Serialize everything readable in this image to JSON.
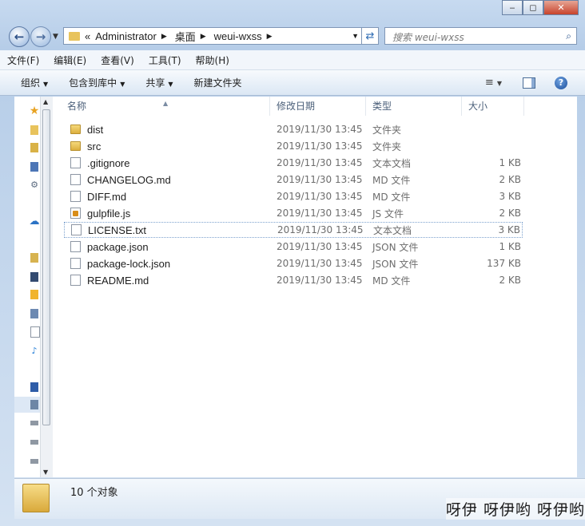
{
  "window": {
    "caption_buttons": {
      "minimize": "‒",
      "maximize": "◻",
      "close": "✕"
    }
  },
  "address_bar": {
    "prefix": "«",
    "crumbs": [
      "Administrator",
      "桌面",
      "weui-wxss"
    ],
    "search_placeholder": "搜索 weui-wxss"
  },
  "menu": [
    "文件(F)",
    "编辑(E)",
    "查看(V)",
    "工具(T)",
    "帮助(H)"
  ],
  "toolbar": {
    "organize": "组织",
    "include_library": "包含到库中",
    "share": "共享",
    "new_folder": "新建文件夹"
  },
  "columns": {
    "name": "名称",
    "date": "修改日期",
    "type": "类型",
    "size": "大小"
  },
  "files": [
    {
      "name": "dist",
      "date": "2019/11/30 13:45",
      "type": "文件夹",
      "size": "",
      "icon": "folder-icon"
    },
    {
      "name": "src",
      "date": "2019/11/30 13:45",
      "type": "文件夹",
      "size": "",
      "icon": "folder-icon"
    },
    {
      "name": ".gitignore",
      "date": "2019/11/30 13:45",
      "type": "文本文档",
      "size": "1 KB",
      "icon": "text-file-icon"
    },
    {
      "name": "CHANGELOG.md",
      "date": "2019/11/30 13:45",
      "type": "MD 文件",
      "size": "2 KB",
      "icon": "file-icon"
    },
    {
      "name": "DIFF.md",
      "date": "2019/11/30 13:45",
      "type": "MD 文件",
      "size": "3 KB",
      "icon": "file-icon"
    },
    {
      "name": "gulpfile.js",
      "date": "2019/11/30 13:45",
      "type": "JS 文件",
      "size": "2 KB",
      "icon": "js-file-icon"
    },
    {
      "name": "LICENSE.txt",
      "date": "2019/11/30 13:45",
      "type": "文本文档",
      "size": "3 KB",
      "icon": "text-file-icon"
    },
    {
      "name": "package.json",
      "date": "2019/11/30 13:45",
      "type": "JSON 文件",
      "size": "1 KB",
      "icon": "file-icon"
    },
    {
      "name": "package-lock.json",
      "date": "2019/11/30 13:45",
      "type": "JSON 文件",
      "size": "137 KB",
      "icon": "file-icon"
    },
    {
      "name": "README.md",
      "date": "2019/11/30 13:45",
      "type": "MD 文件",
      "size": "2 KB",
      "icon": "file-icon"
    }
  ],
  "status_bar": {
    "count": "10 个对象"
  },
  "watermark": "呀伊 呀伊哟 呀伊哟"
}
